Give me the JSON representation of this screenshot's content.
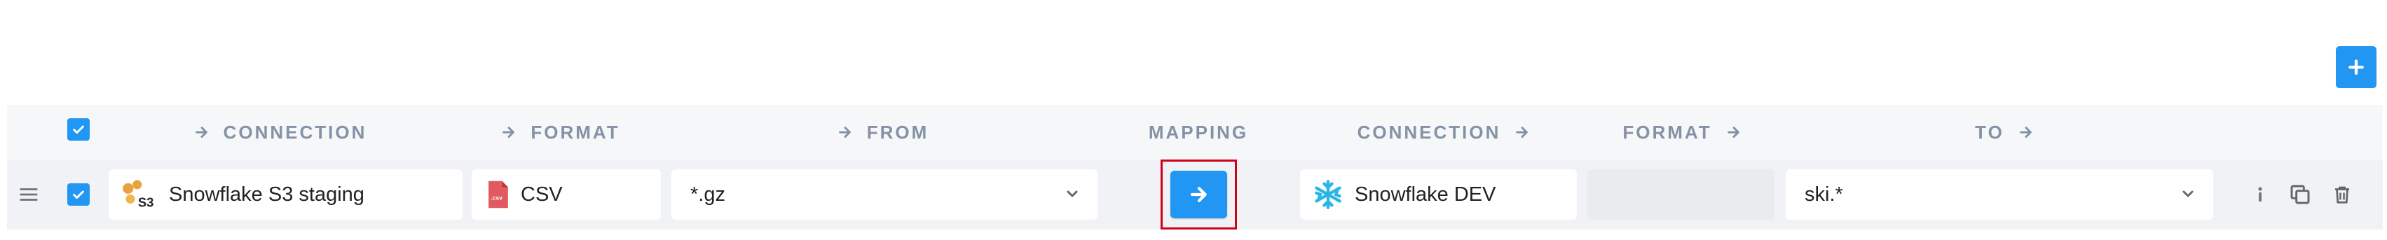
{
  "toolbar": {
    "add_button_icon": "plus-icon"
  },
  "header": {
    "select_all_checked": true,
    "columns": {
      "source_connection": "CONNECTION",
      "source_format": "FORMAT",
      "from": "FROM",
      "mapping": "MAPPING",
      "destination_connection": "CONNECTION",
      "destination_format": "FORMAT",
      "to": "TO"
    }
  },
  "row": {
    "checked": true,
    "source_connection": {
      "label": "Snowflake S3 staging",
      "icon": "s3-bucket-icon"
    },
    "source_format": {
      "label": "CSV",
      "icon": "csv-file-icon",
      "icon_text": ".csv"
    },
    "from": {
      "value": "*.gz"
    },
    "mapping": {
      "icon": "arrow-right-icon"
    },
    "destination_connection": {
      "label": "Snowflake DEV",
      "icon": "snowflake-icon"
    },
    "destination_format": {
      "label": ""
    },
    "to": {
      "value": "ski.*"
    },
    "actions": [
      "info-icon",
      "copy-icon",
      "delete-icon"
    ]
  },
  "colors": {
    "accent": "#2196f3",
    "header_text": "#8492a6",
    "highlight_border": "#d0021b",
    "csv_red": "#e05a5f",
    "snowflake_teal": "#29b5e8",
    "s3_orange": "#e8a33d"
  }
}
